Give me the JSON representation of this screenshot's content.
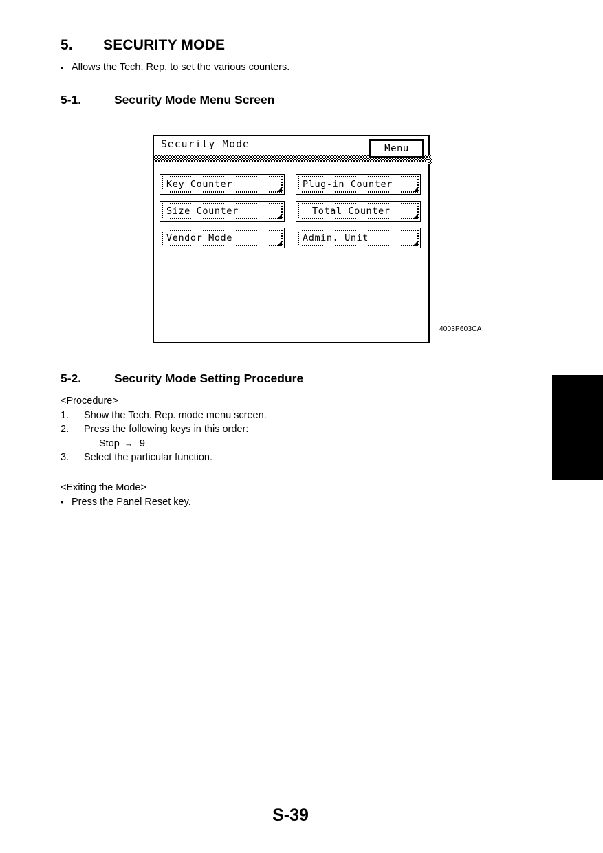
{
  "section": {
    "number": "5.",
    "title": "SECURITY MODE",
    "intro_bullet": "Allows the Tech. Rep. to set the various counters.",
    "bullet_glyph": "•"
  },
  "subsections": [
    {
      "number": "5-1.",
      "title": "Security Mode Menu Screen"
    },
    {
      "number": "5-2.",
      "title": "Security Mode Setting Procedure"
    }
  ],
  "figure": {
    "caption_code": "4003P603CA",
    "lcd": {
      "title": "Security Mode",
      "menu_button": "Menu",
      "buttons": [
        {
          "label": "Key Counter",
          "column": "left"
        },
        {
          "label": "Plug-in Counter",
          "column": "right"
        },
        {
          "label": "Size Counter",
          "column": "left"
        },
        {
          "label": "Total Counter",
          "column": "right"
        },
        {
          "label": "Vendor Mode",
          "column": "left"
        },
        {
          "label": "Admin. Unit",
          "column": "right"
        }
      ]
    }
  },
  "procedure": {
    "heading": "<Procedure>",
    "steps": [
      {
        "num": "1.",
        "text": "Show the Tech. Rep. mode menu screen."
      },
      {
        "num": "2.",
        "text": "Press the following keys in this order:"
      },
      {
        "num": "3.",
        "text": "Select the particular function."
      }
    ],
    "key_sequence": {
      "first": "Stop",
      "arrow": "→",
      "second": "9"
    }
  },
  "exiting": {
    "heading": "<Exiting the Mode>",
    "bullet_glyph": "•",
    "text": "Press the Panel Reset key."
  },
  "footer": {
    "page_label": "S-39"
  },
  "colors": {
    "ink": "#000000",
    "paper": "#ffffff"
  }
}
